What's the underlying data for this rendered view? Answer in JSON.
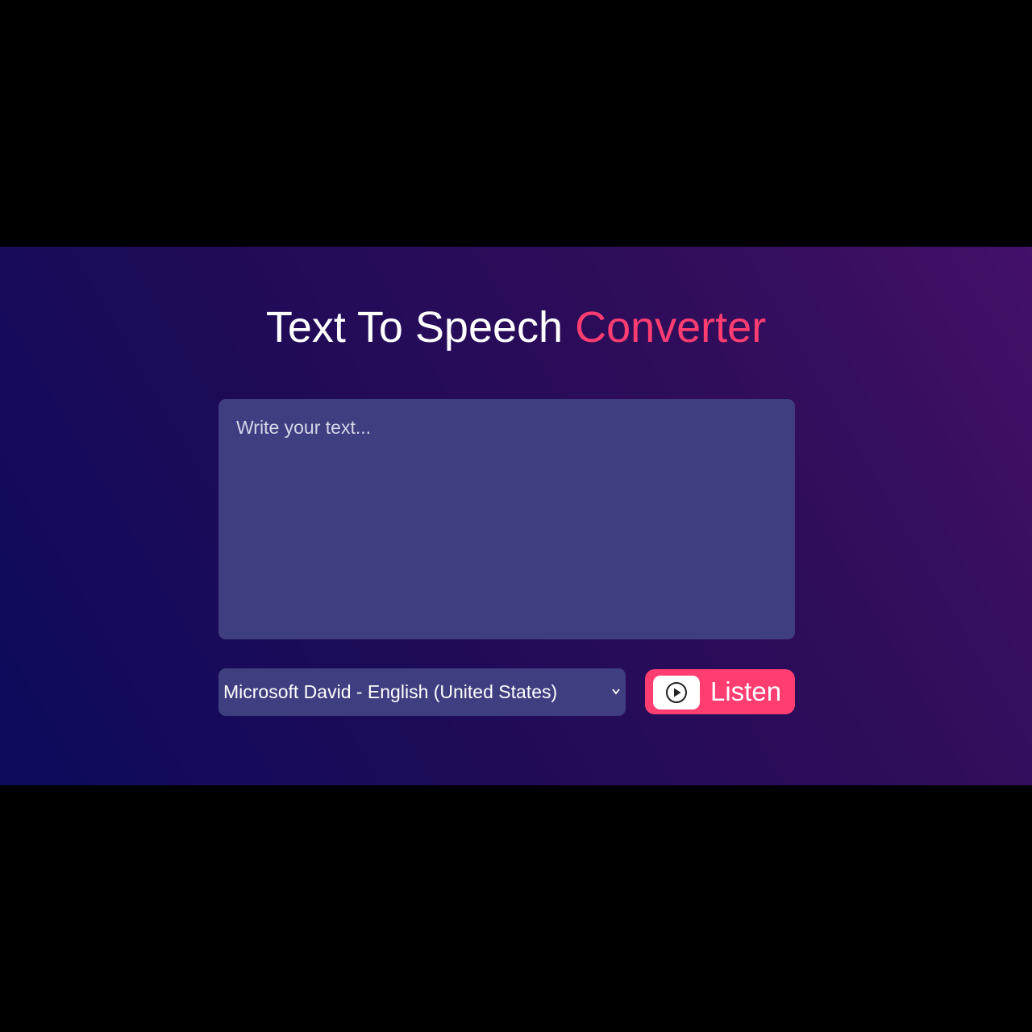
{
  "header": {
    "title_main": "Text To Speech",
    "title_accent": "Converter"
  },
  "editor": {
    "placeholder": "Write your text...",
    "value": ""
  },
  "voice_select": {
    "selected": "Microsoft David - English (United States)"
  },
  "listen_button": {
    "label": "Listen",
    "icon": "play-circle-icon"
  },
  "colors": {
    "accent": "#ff3d71",
    "panel": "#3f3e80",
    "background_start": "#0c0b5c",
    "background_end": "#43106a"
  }
}
